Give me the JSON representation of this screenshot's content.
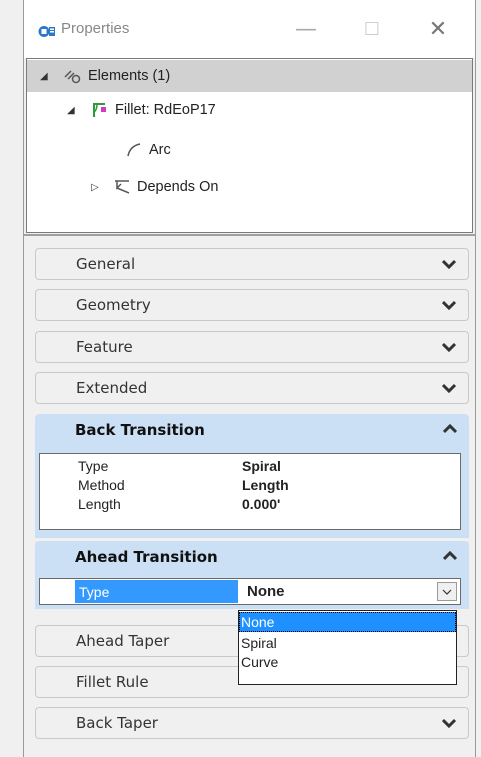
{
  "window": {
    "title": "Properties",
    "controls": {
      "minimize": "—",
      "maximize": "☐",
      "close": "✕"
    }
  },
  "tree": {
    "items": [
      {
        "label": "Elements (1)",
        "icon": "elements-icon",
        "expander": "◢"
      },
      {
        "label": "Fillet: RdEoP17",
        "icon": "fillet-icon",
        "expander": "◢"
      },
      {
        "label": "Arc",
        "icon": "arc-icon",
        "expander": ""
      },
      {
        "label": "Depends On",
        "icon": "depends-on-icon",
        "expander": "▷"
      }
    ]
  },
  "sections": {
    "general": "General",
    "geometry": "Geometry",
    "feature": "Feature",
    "extended": "Extended",
    "back_transition": {
      "title": "Back Transition",
      "rows": [
        {
          "label": "Type",
          "value": "Spiral"
        },
        {
          "label": "Method",
          "value": "Length"
        },
        {
          "label": "Length",
          "value": "0.000'"
        }
      ]
    },
    "ahead_transition": {
      "title": "Ahead Transition",
      "type_label": "Type",
      "type_value": "None"
    },
    "ahead_taper": "Ahead Taper",
    "fillet_rule": "Fillet Rule",
    "back_taper": "Back Taper"
  },
  "dropdown": {
    "options": [
      "None",
      "Spiral",
      "Curve"
    ],
    "selected": "None"
  },
  "colors": {
    "accent": "#3399ff",
    "section_expanded_bg": "#cce0f5",
    "tree_selected": "#d1d1d1"
  }
}
